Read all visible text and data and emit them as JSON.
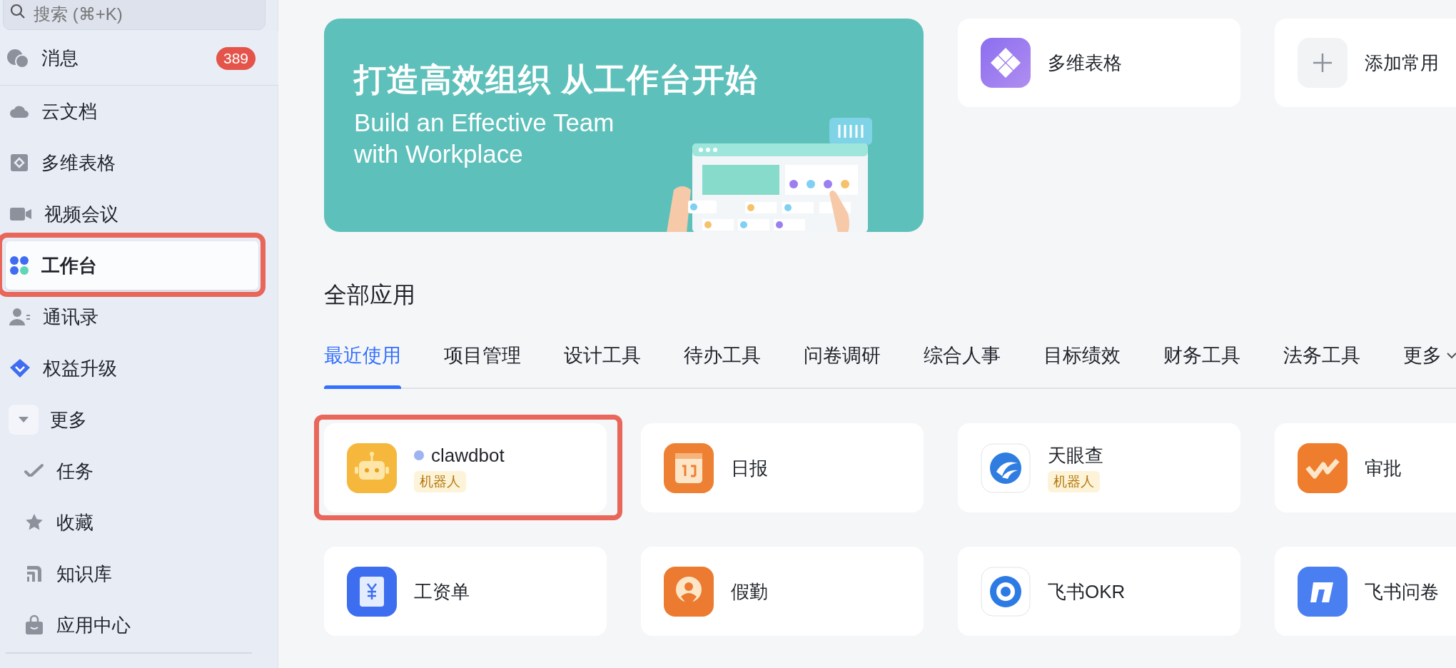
{
  "sidebar": {
    "search": {
      "placeholder": "搜索 (⌘+K)"
    },
    "pinned": {
      "label": "消息",
      "badge": "389"
    },
    "items": [
      {
        "label": "云文档",
        "selected": false
      },
      {
        "label": "多维表格",
        "selected": false
      },
      {
        "label": "视频会议",
        "selected": false
      },
      {
        "label": "工作台",
        "selected": true,
        "highlighted": true
      },
      {
        "label": "通讯录",
        "selected": false
      },
      {
        "label": "权益升级",
        "selected": false
      },
      {
        "label": "更多",
        "selected": false,
        "expanded": true,
        "children": [
          {
            "label": "任务",
            "selected": false
          },
          {
            "label": "收藏",
            "selected": false
          },
          {
            "label": "知识库",
            "selected": false
          },
          {
            "label": "应用中心",
            "selected": false
          }
        ]
      }
    ]
  },
  "banner": {
    "title": "打造高效组织 从工作台开始",
    "subtitle": [
      "Build an Effective Team",
      "with Workplace"
    ]
  },
  "shortcuts": [
    {
      "kind": "app",
      "label": "多维表格"
    },
    {
      "kind": "add",
      "label": "添加常用"
    }
  ],
  "section_title": "全部应用",
  "tabs": [
    {
      "label": "最近使用",
      "selected": true
    },
    {
      "label": "项目管理",
      "selected": false
    },
    {
      "label": "设计工具",
      "selected": false
    },
    {
      "label": "待办工具",
      "selected": false
    },
    {
      "label": "问卷调研",
      "selected": false
    },
    {
      "label": "综合人事",
      "selected": false
    },
    {
      "label": "目标绩效",
      "selected": false
    },
    {
      "label": "财务工具",
      "selected": false
    },
    {
      "label": "法务工具",
      "selected": false
    },
    {
      "label": "更多",
      "selected": false,
      "kind": "dropdown"
    }
  ],
  "apps": [
    {
      "name": "clawdbot",
      "color": "#9fb2f2",
      "tag": "机器人",
      "highlighted": true
    },
    {
      "name": "日报"
    },
    {
      "name": "天眼查",
      "tag": "机器人"
    },
    {
      "name": "审批"
    },
    {
      "name": "工资单"
    },
    {
      "name": "假勤"
    },
    {
      "name": "飞书OKR"
    },
    {
      "name": "飞书问卷"
    }
  ]
}
